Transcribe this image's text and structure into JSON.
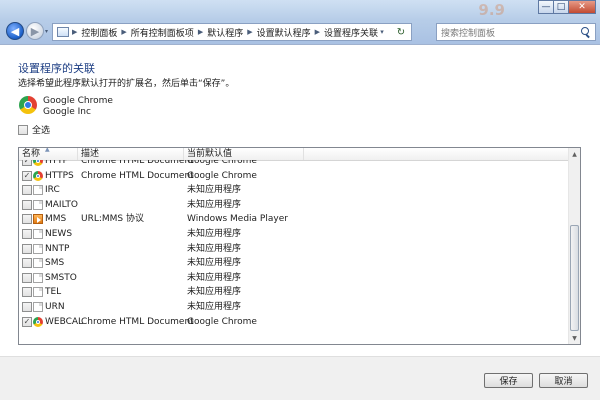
{
  "window": {
    "minimize": "—",
    "maximize": "□",
    "close": "✕",
    "background_promo": "9.9"
  },
  "nav": {
    "back": "◀",
    "forward": "▶",
    "history_dropdown": "▾",
    "breadcrumbs": [
      "控制面板",
      "所有控制面板项",
      "默认程序",
      "设置默认程序",
      "设置程序关联"
    ],
    "breadcrumb_separator": "▶",
    "address_dropdown": "▾",
    "refresh": "↻",
    "search_placeholder": "搜索控制面板"
  },
  "page": {
    "title": "设置程序的关联",
    "instruction": "选择希望此程序默认打开的扩展名，然后单击“保存”。",
    "program_name": "Google Chrome",
    "program_vendor": "Google Inc",
    "select_all_label": "全选"
  },
  "list": {
    "columns": [
      "名称",
      "描述",
      "当前默认值"
    ],
    "sort_indicator": "▲",
    "partial_row": {
      "name": "HTTP",
      "description": "Chrome HTML Document",
      "default": "Google Chrome",
      "checked": true,
      "icon": "chrome"
    },
    "rows": [
      {
        "name": "HTTPS",
        "description": "Chrome HTML Document",
        "default": "Google Chrome",
        "checked": true,
        "icon": "chrome"
      },
      {
        "name": "IRC",
        "description": "",
        "default": "未知应用程序",
        "checked": false,
        "icon": "doc"
      },
      {
        "name": "MAILTO",
        "description": "",
        "default": "未知应用程序",
        "checked": false,
        "icon": "doc"
      },
      {
        "name": "MMS",
        "description": "URL:MMS 协议",
        "default": "Windows Media Player",
        "checked": false,
        "icon": "wmp"
      },
      {
        "name": "NEWS",
        "description": "",
        "default": "未知应用程序",
        "checked": false,
        "icon": "doc"
      },
      {
        "name": "NNTP",
        "description": "",
        "default": "未知应用程序",
        "checked": false,
        "icon": "doc"
      },
      {
        "name": "SMS",
        "description": "",
        "default": "未知应用程序",
        "checked": false,
        "icon": "doc"
      },
      {
        "name": "SMSTO",
        "description": "",
        "default": "未知应用程序",
        "checked": false,
        "icon": "doc"
      },
      {
        "name": "TEL",
        "description": "",
        "default": "未知应用程序",
        "checked": false,
        "icon": "doc"
      },
      {
        "name": "URN",
        "description": "",
        "default": "未知应用程序",
        "checked": false,
        "icon": "doc"
      },
      {
        "name": "WEBCAL",
        "description": "Chrome HTML Document",
        "default": "Google Chrome",
        "checked": true,
        "icon": "chrome"
      }
    ],
    "scroll_up": "▲",
    "scroll_down": "▼"
  },
  "buttons": {
    "save": "保存",
    "cancel": "取消"
  }
}
